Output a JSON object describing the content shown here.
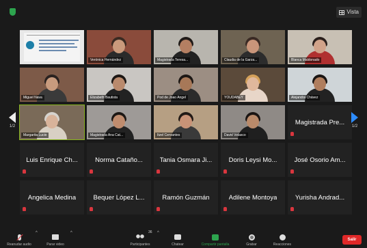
{
  "topbar": {
    "view_label": "Vista"
  },
  "nav": {
    "left_page": "1/2",
    "right_page": "1/2"
  },
  "tiles": [
    {
      "kind": "doc",
      "label": ""
    },
    {
      "kind": "video",
      "label": "Verónica Hernández",
      "bg": "#8a4b3b",
      "head": "#c99a7c",
      "body": "#2a2a2a",
      "hair": "#3a2a22"
    },
    {
      "kind": "video",
      "label": "Magistrada Teresa...",
      "bg": "#b8b5ae",
      "head": "#b47f62",
      "body": "#222",
      "hair": "#1f1a18"
    },
    {
      "kind": "video",
      "label": "Claudia de la Garza...",
      "bg": "#6e6352",
      "head": "#c9957a",
      "body": "#2c2c2c",
      "hair": "#3a2a24"
    },
    {
      "kind": "video",
      "label": "Blanca Maldonado",
      "bg": "#c8c0b4",
      "head": "#d1a38a",
      "body": "#b03030",
      "hair": "#2a1f1c"
    },
    {
      "kind": "video",
      "label": "Miguel Nava",
      "bg": "#7d5a48",
      "head": "#c89b7e",
      "body": "#3a3a3a",
      "hair": "#2a2220"
    },
    {
      "kind": "video",
      "label": "Elizabeth Bautista",
      "bg": "#c9c6c2",
      "head": "#b98a6d",
      "body": "#222",
      "hair": "#1c1714"
    },
    {
      "kind": "video",
      "label": "Pod de Joao Angel",
      "bg": "#9c8e83",
      "head": "#a77858",
      "body": "#2b2b2b",
      "hair": "#1c1714"
    },
    {
      "kind": "video",
      "label": "YOUDABEY",
      "bg": "#5b4a3a",
      "head": "#e0b89c",
      "body": "#e8d6c8",
      "hair": "#d4a15a"
    },
    {
      "kind": "video",
      "label": "Alejandra Chávez",
      "bg": "#cfd5d8",
      "head": "#b07e5e",
      "body": "#222",
      "hair": "#1a1513"
    },
    {
      "kind": "video",
      "label": "Margarita Lucio",
      "bg": "#7a6a58",
      "head": "#d8b39a",
      "body": "#d8d0c4",
      "hair": "#d6d3ce",
      "speaking": true
    },
    {
      "kind": "video",
      "label": "Magistrada Ana Cat...",
      "bg": "#9e9a97",
      "head": "#bf8c6e",
      "body": "#222",
      "hair": "#1c1714"
    },
    {
      "kind": "video",
      "label": "Itzel Cervantes",
      "bg": "#b69f83",
      "head": "#c99377",
      "body": "#3a3a3a",
      "hair": "#221a16"
    },
    {
      "kind": "video",
      "label": "David Velasco",
      "bg": "#8f8a86",
      "head": "#b98a6a",
      "body": "#1f1f1f",
      "hair": "#1a1513"
    },
    {
      "kind": "name",
      "label": "Magistrada Pre..."
    },
    {
      "kind": "name",
      "label": "Luis Enrique Ch..."
    },
    {
      "kind": "name",
      "label": "Norma Cataño..."
    },
    {
      "kind": "name",
      "label": "Tania Osmara Ji..."
    },
    {
      "kind": "name",
      "label": "Doris Leysi Mo..."
    },
    {
      "kind": "name",
      "label": "José Osorio Am..."
    },
    {
      "kind": "name",
      "label": "Angelica Medina"
    },
    {
      "kind": "name",
      "label": "Bequer López L..."
    },
    {
      "kind": "name",
      "label": "Ramón Guzmán"
    },
    {
      "kind": "name",
      "label": "Adilene Montoya"
    },
    {
      "kind": "name",
      "label": "Yurisha Andrad..."
    }
  ],
  "toolbar": {
    "mute_label": "Reanudar audio",
    "video_label": "Parar video",
    "participants_label": "Participantes",
    "participants_count": "36",
    "chat_label": "Chatear",
    "share_label": "Compartir pantalla",
    "record_label": "Grabar",
    "reactions_label": "Reacciones",
    "leave_label": "Salir"
  },
  "colors": {
    "accent_blue": "#2d8cff",
    "share_green": "#2da44e",
    "leave_red": "#e02828",
    "speaker_outline": "#8ab71f"
  }
}
